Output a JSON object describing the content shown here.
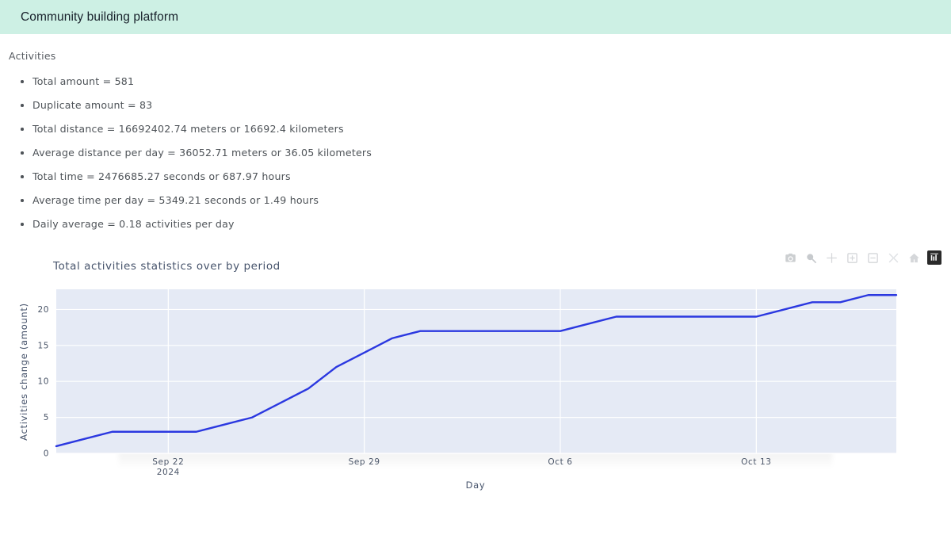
{
  "header": {
    "title": "Community building platform",
    "background_color": "#cdf0e4"
  },
  "stats": {
    "heading": "Activities",
    "items": [
      "Total amount = 581",
      "Duplicate amount = 83",
      "Total distance = 16692402.74 meters or 16692.4 kilometers",
      "Average distance per day = 36052.71 meters or 36.05 kilometers",
      "Total time = 2476685.27 seconds or 687.97 hours",
      "Average time per day = 5349.21 seconds or 1.49 hours",
      "Daily average = 0.18 activities per day"
    ]
  },
  "modebar": {
    "buttons": [
      {
        "name": "download-plot-as-png-icon",
        "title": "Download plot as a png"
      },
      {
        "name": "zoom-icon",
        "title": "Zoom"
      },
      {
        "name": "pan-icon",
        "title": "Pan"
      },
      {
        "name": "zoom-in-icon",
        "title": "Zoom in"
      },
      {
        "name": "zoom-out-icon",
        "title": "Zoom out"
      },
      {
        "name": "autoscale-icon",
        "title": "Autoscale"
      },
      {
        "name": "reset-axes-icon",
        "title": "Reset axes"
      },
      {
        "name": "plotly-logo-icon",
        "title": "Produced with Plotly"
      }
    ]
  },
  "chart_data": {
    "type": "line",
    "title": "Total activities statistics over by period",
    "xlabel": "Day",
    "ylabel": "Activities change (amount)",
    "x_tick_labels": [
      "Sep 22",
      "Sep 29",
      "Oct 6",
      "Oct 13"
    ],
    "x_tick_sublabel": "2024",
    "y_tick_labels": [
      "0",
      "5",
      "10",
      "15",
      "20"
    ],
    "ylim": [
      0,
      22.8
    ],
    "xlim": [
      "2024-09-18",
      "2024-10-18"
    ],
    "grid": true,
    "legend": "none",
    "line_color": "#2b38e0",
    "plot_bg_color": "#e5eaf5",
    "paper_bg_color": "#ffffff",
    "x": [
      "2024-09-18",
      "2024-09-19",
      "2024-09-20",
      "2024-09-21",
      "2024-09-22",
      "2024-09-23",
      "2024-09-24",
      "2024-09-25",
      "2024-09-26",
      "2024-09-27",
      "2024-09-28",
      "2024-09-29",
      "2024-09-30",
      "2024-10-01",
      "2024-10-02",
      "2024-10-03",
      "2024-10-04",
      "2024-10-05",
      "2024-10-06",
      "2024-10-07",
      "2024-10-08",
      "2024-10-09",
      "2024-10-10",
      "2024-10-11",
      "2024-10-12",
      "2024-10-13",
      "2024-10-14",
      "2024-10-15",
      "2024-10-16",
      "2024-10-17",
      "2024-10-18"
    ],
    "values": [
      1,
      2,
      3,
      3,
      3,
      3,
      4,
      5,
      7,
      9,
      12,
      14,
      16,
      17,
      17,
      17,
      17,
      17,
      17,
      18,
      19,
      19,
      19,
      19,
      19,
      19,
      20,
      21,
      21,
      22,
      22
    ],
    "series": [
      {
        "name": "Activities change",
        "values": [
          1,
          2,
          3,
          3,
          3,
          3,
          4,
          5,
          7,
          9,
          12,
          14,
          16,
          17,
          17,
          17,
          17,
          17,
          17,
          18,
          19,
          19,
          19,
          19,
          19,
          19,
          20,
          21,
          21,
          22,
          22
        ]
      }
    ]
  }
}
